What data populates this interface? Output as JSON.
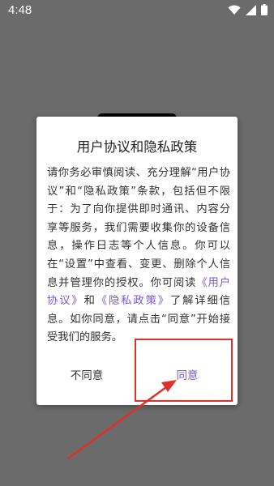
{
  "status": {
    "time": "4:48",
    "icons": [
      "wifi-icon",
      "signal-icon",
      "battery-icon"
    ]
  },
  "dialog": {
    "title": "用户协议和隐私政策",
    "body_intro": "请你务必审慎阅读、充分理解“用户协议”和“隐私政策”条款，包括但不限于：为了向你提供即时通讯、内容分享等服务，我们需要收集你的设备信息，操作日志等个人信息。你可以在“设置”中查看、变更、删除个人信息并管理你的授权。你可阅读",
    "link_terms": "《用户协议》",
    "and_text": "和",
    "link_privacy": "《隐私政策》",
    "body_outro": "了解详细信息。如你同意，请点击“同意”开始接受我们的服务。",
    "decline_label": "不同意",
    "agree_label": "同意"
  },
  "colors": {
    "accent": "#7b58d8",
    "annotation": "#e0302a",
    "overlay": "#6b6b6b"
  }
}
